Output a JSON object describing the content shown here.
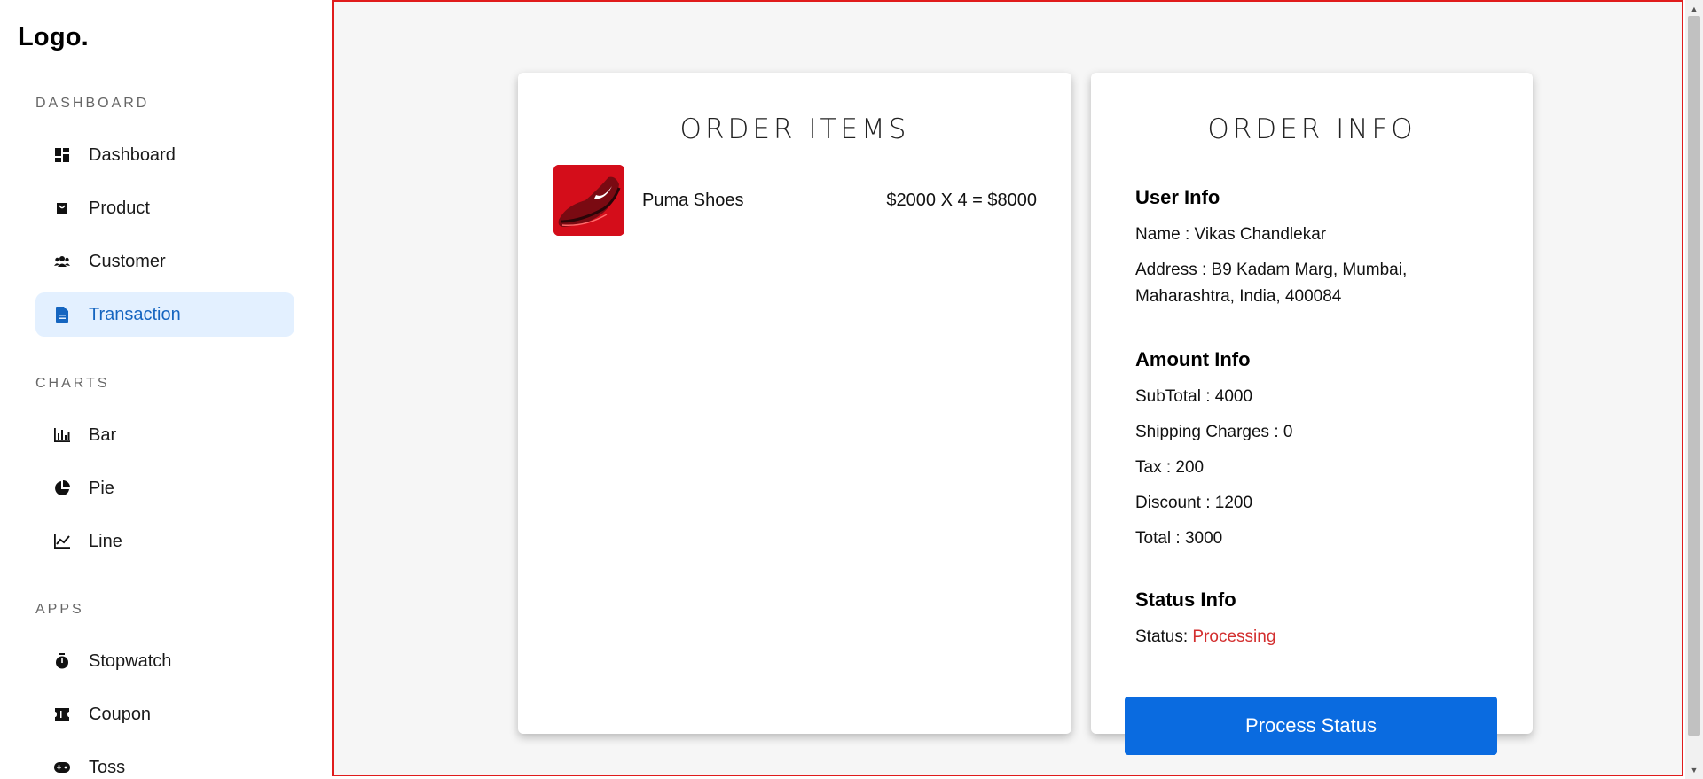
{
  "sidebar": {
    "logo": "Logo.",
    "sections": [
      {
        "title": "DASHBOARD",
        "items": [
          {
            "label": "Dashboard",
            "icon": "dashboard-icon"
          },
          {
            "label": "Product",
            "icon": "shopping-bag-icon"
          },
          {
            "label": "Customer",
            "icon": "people-icon"
          },
          {
            "label": "Transaction",
            "icon": "document-icon",
            "active": true
          }
        ]
      },
      {
        "title": "CHARTS",
        "items": [
          {
            "label": "Bar",
            "icon": "bar-chart-icon"
          },
          {
            "label": "Pie",
            "icon": "pie-chart-icon"
          },
          {
            "label": "Line",
            "icon": "line-chart-icon"
          }
        ]
      },
      {
        "title": "APPS",
        "items": [
          {
            "label": "Stopwatch",
            "icon": "stopwatch-icon"
          },
          {
            "label": "Coupon",
            "icon": "coupon-icon"
          },
          {
            "label": "Toss",
            "icon": "gamepad-icon"
          }
        ]
      }
    ]
  },
  "order_items": {
    "title": "ORDER ITEMS",
    "items": [
      {
        "name": "Puma Shoes",
        "price_text": "$2000 X 4 = $8000"
      }
    ]
  },
  "order_info": {
    "title": "ORDER INFO",
    "user_heading": "User Info",
    "name_line": "Name : Vikas Chandlekar",
    "address_line": "Address : B9 Kadam Marg, Mumbai, Maharashtra, India, 400084",
    "amount_heading": "Amount Info",
    "subtotal": "SubTotal : 4000",
    "shipping": "Shipping Charges : 0",
    "tax": "Tax : 200",
    "discount": "Discount : 1200",
    "total": "Total : 3000",
    "status_heading": "Status Info",
    "status_label": "Status: ",
    "status_value": "Processing",
    "button_label": "Process Status"
  },
  "colors": {
    "accent": "#0a6be0",
    "active_bg": "#e3f0ff",
    "active_text": "#1565c0",
    "status_processing": "#d32f2f",
    "outline": "#e01c1c"
  }
}
